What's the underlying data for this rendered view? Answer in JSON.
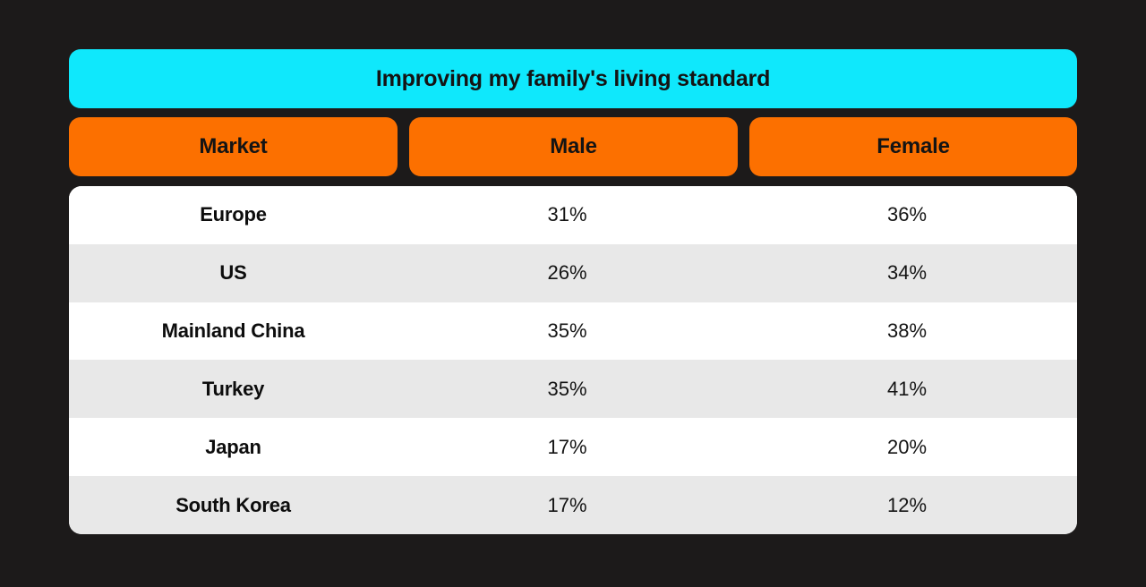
{
  "colors": {
    "background": "#1c1a1a",
    "title_banner": "#0fe8fc",
    "header_pill": "#fc7000",
    "row_white": "#ffffff",
    "row_alt": "#e8e8e8",
    "text_dark": "#141414"
  },
  "title": {
    "text": "Improving my family's living standard"
  },
  "chart_data": {
    "type": "table",
    "title": "Improving my family's living standard",
    "columns": [
      "Market",
      "Male",
      "Female"
    ],
    "categories": [
      "Europe",
      "US",
      "Mainland China",
      "Turkey",
      "Japan",
      "South Korea"
    ],
    "series": [
      {
        "name": "Male",
        "values": [
          "31%",
          "26%",
          "35%",
          "35%",
          "17%",
          "17%"
        ]
      },
      {
        "name": "Female",
        "values": [
          "36%",
          "34%",
          "38%",
          "41%",
          "20%",
          "12%"
        ]
      }
    ],
    "rows": [
      {
        "market": "Europe",
        "male": "31%",
        "female": "36%"
      },
      {
        "market": "US",
        "male": "26%",
        "female": "34%"
      },
      {
        "market": "Mainland China",
        "male": "35%",
        "female": "38%"
      },
      {
        "market": "Turkey",
        "male": "35%",
        "female": "41%"
      },
      {
        "market": "Japan",
        "male": "17%",
        "female": "20%"
      },
      {
        "market": "South Korea",
        "male": "17%",
        "female": "12%"
      }
    ],
    "xlabel": "",
    "ylabel": "",
    "legend": "none",
    "grid": false
  }
}
